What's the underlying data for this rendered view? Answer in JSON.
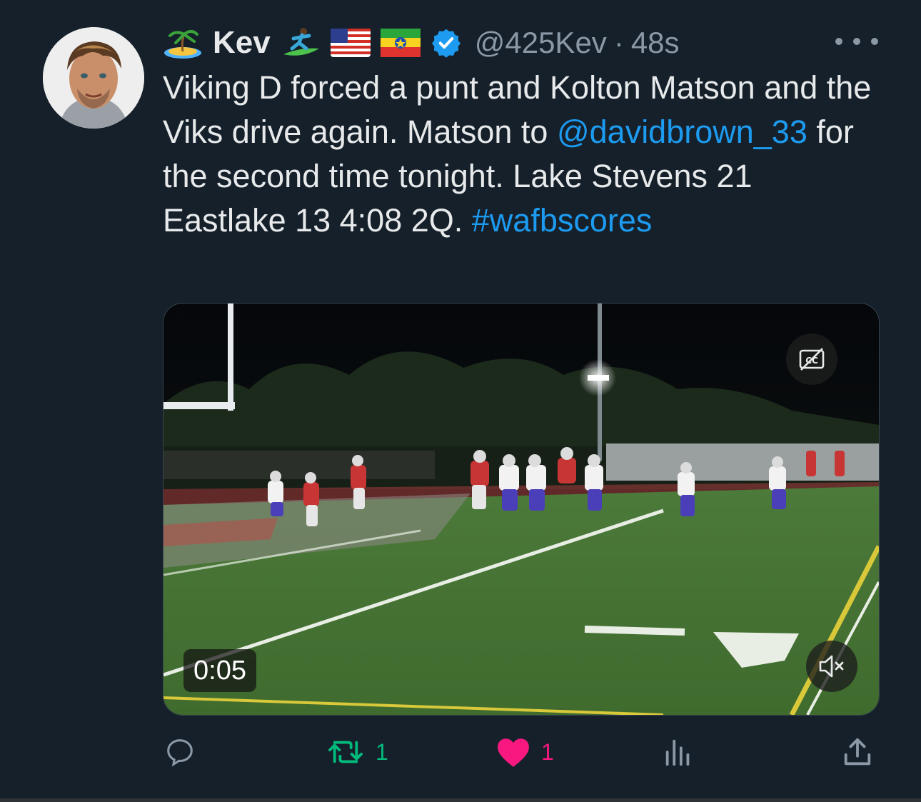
{
  "author": {
    "name": "Kev",
    "handle": "@425Kev",
    "separator": "·",
    "timestamp": "48s",
    "verified": true,
    "badges": [
      "desert-island-emoji",
      "surfer-emoji",
      "us-flag-emoji",
      "ethiopia-flag-emoji"
    ]
  },
  "tweet": {
    "text_part1": "Viking D forced a punt and Kolton Matson and the Viks drive again. Matson to ",
    "mention": "@davidbrown_33",
    "text_part2": " for the second time tonight. Lake Stevens 21 Eastlake 13 4:08 2Q. ",
    "hashtag": "#wafbscores"
  },
  "media": {
    "type": "video",
    "duration": "0:05",
    "captions_icon": "cc-off-icon",
    "volume_icon": "muted-speaker-icon"
  },
  "actions": {
    "reply_count": "",
    "retweet_count": "1",
    "like_count": "1",
    "liked": true,
    "retweet_color": "#00ba7c",
    "like_color": "#f91880"
  },
  "colors": {
    "background": "#15202b",
    "link": "#1d9bf0",
    "muted": "#8b98a5"
  }
}
